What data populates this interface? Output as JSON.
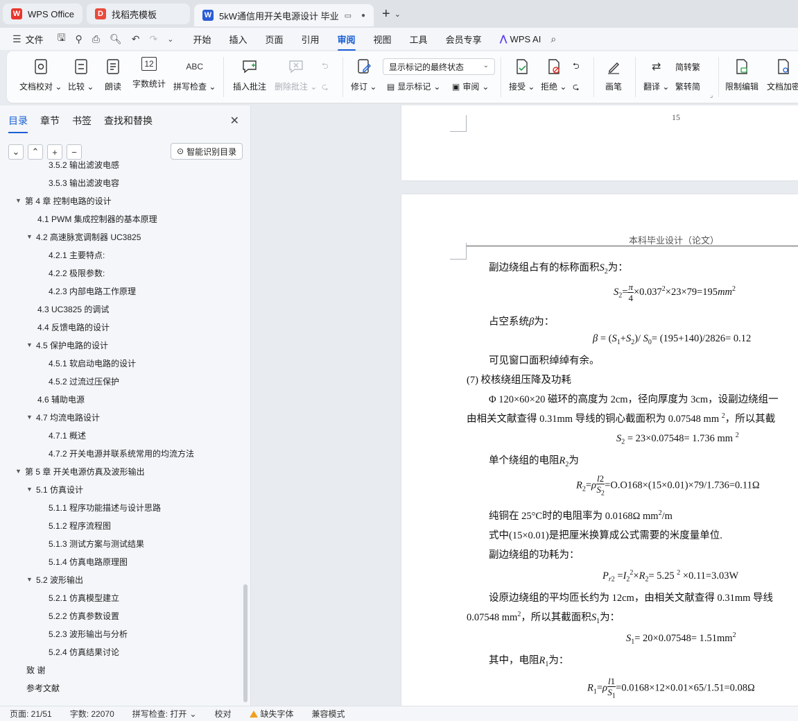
{
  "tabs": [
    {
      "label": "WPS Office",
      "icon": "wps-logo-icon"
    },
    {
      "label": "找稻壳模板",
      "icon": "docer-logo-icon"
    },
    {
      "label": "5kW通信用开关电源设计 毕业",
      "icon": "word-doc-icon"
    }
  ],
  "menu": {
    "file": "文件",
    "items": [
      "开始",
      "插入",
      "页面",
      "引用",
      "审阅",
      "视图",
      "工具",
      "会员专享"
    ],
    "active": "审阅",
    "ai": "WPS AI"
  },
  "ribbon": {
    "doc_check": "文档校对",
    "compare": "比较",
    "read_aloud": "朗读",
    "word_count": "字数统计",
    "spell_check": "拼写检查",
    "spell_icon_text": "ABC",
    "word_count_icon_text": "12",
    "insert_comment": "插入批注",
    "delete_comment": "删除批注",
    "track_changes": "修订",
    "markup_select": "显示标记的最终状态",
    "show_markup": "显示标记",
    "review_pane": "审阅",
    "accept": "接受",
    "reject": "拒绝",
    "pen": "画笔",
    "translate": "翻译",
    "to_traditional": "简转繁",
    "to_simplified": "繁转简",
    "restrict_edit": "限制编辑",
    "encrypt": "文档加密"
  },
  "sidebar": {
    "tabs": [
      "目录",
      "章节",
      "书签",
      "查找和替换"
    ],
    "active_tab": "目录",
    "smart_toc": "智能识别目录",
    "toc": [
      {
        "label": "3.5.2  输出滤波电感",
        "level": 3,
        "toggle": ""
      },
      {
        "label": "3.5.3  输出滤波电容",
        "level": 3,
        "toggle": ""
      },
      {
        "label": "第 4 章  控制电路的设计",
        "level": 1,
        "toggle": "▼"
      },
      {
        "label": "4.1 PWM 集成控制器的基本原理",
        "level": 2,
        "toggle": ""
      },
      {
        "label": "4.2  高速脉宽调制器 UC3825",
        "level": 2,
        "toggle": "▼"
      },
      {
        "label": "4.2.1  主要特点:",
        "level": 3,
        "toggle": ""
      },
      {
        "label": "4.2.2  极限参数:",
        "level": 3,
        "toggle": ""
      },
      {
        "label": "4.2.3  内部电路工作原理",
        "level": 3,
        "toggle": ""
      },
      {
        "label": "4.3    UC3825 的调试",
        "level": 2,
        "toggle": ""
      },
      {
        "label": "4.4  反馈电路的设计",
        "level": 2,
        "toggle": ""
      },
      {
        "label": "4.5 保护电路的设计",
        "level": 2,
        "toggle": "▼"
      },
      {
        "label": "4.5.1 软启动电路的设计",
        "level": 3,
        "toggle": ""
      },
      {
        "label": "4.5.2 过流过压保护",
        "level": 3,
        "toggle": ""
      },
      {
        "label": "4.6  辅助电源",
        "level": 2,
        "toggle": ""
      },
      {
        "label": "4.7  均流电路设计",
        "level": 2,
        "toggle": "▼"
      },
      {
        "label": "4.7.1  概述",
        "level": 3,
        "toggle": ""
      },
      {
        "label": "4.7.2  开关电源并联系统常用的均流方法",
        "level": 3,
        "toggle": ""
      },
      {
        "label": "第 5 章  开关电源仿真及波形输出",
        "level": 1,
        "toggle": "▼"
      },
      {
        "label": "5.1 仿真设计",
        "level": 2,
        "toggle": "▼"
      },
      {
        "label": "5.1.1 程序功能描述与设计思路",
        "level": 3,
        "toggle": ""
      },
      {
        "label": "5.1.2 程序流程图",
        "level": 3,
        "toggle": ""
      },
      {
        "label": "5.1.3 测试方案与测试结果",
        "level": 3,
        "toggle": ""
      },
      {
        "label": "5.1.4 仿真电路原理图",
        "level": 3,
        "toggle": ""
      },
      {
        "label": "5.2  波形输出",
        "level": 2,
        "toggle": "▼"
      },
      {
        "label": "5.2.1  仿真模型建立",
        "level": 3,
        "toggle": ""
      },
      {
        "label": "5.2.2  仿真参数设置",
        "level": 3,
        "toggle": ""
      },
      {
        "label": "5.2.3  波形输出与分析",
        "level": 3,
        "toggle": ""
      },
      {
        "label": "5.2.4  仿真结果讨论",
        "level": 3,
        "toggle": ""
      },
      {
        "label": "致    谢",
        "level": 1,
        "toggle": ""
      },
      {
        "label": "参考文献",
        "level": 1,
        "toggle": ""
      }
    ]
  },
  "document": {
    "page_number": "15",
    "header": "本科毕业设计（论文）",
    "p1": "副边绕组占有的标称面积",
    "p1_tail": "为：",
    "p2": "占空系统",
    "p2_tail": "为：",
    "p3": "可见窗口面积绰绰有余。",
    "p4": "(7)  校核绕组压降及功耗",
    "p5": "Φ 120×60×20 磁环的高度为 2cm，径向厚度为 3cm，设副边绕组一",
    "p6": "由相关文献查得 0.31mm 导线的铜心截面积为 0.07548 mm ",
    "p6_tail": "，所以其截",
    "eq_s2b": "= 23×0.07548= 1.736 mm ",
    "p7": "单个绕组的电阻",
    "p7_tail": "为",
    "eq_r2": "=O.O168×(15×0.01)×79/1.736=0.11Ω",
    "p8": "纯铜在 25°C时的电阻率为 0.0168Ω   mm",
    "p8_tail": "/m",
    "p9": "式中(15×0.01)是把厘米换算成公式需要的米度量单位.",
    "p10": "副边绕组的功耗为：",
    "eq_pr2": "= 5.25 ",
    "eq_pr2_tail": " ×0.11=3.03W",
    "p11": "设原边绕组的平均匝长约为 12cm，由相关文献查得 0.31mm 导线",
    "p12": "0.07548 mm",
    "p12_mid": "，所以其截面积",
    "p12_tail": "为：",
    "eq_s1": "= 20×0.07548= 1.51mm",
    "p13": "其中，电阻",
    "p13_tail": "为：",
    "eq_r1": "=0.0168×12×0.01×65/1.51=0.08Ω",
    "eq_s2": "×0.037",
    "eq_s2_tail": "×23×79=195",
    "eq_beta": "= (195+140)/2826= 0.12"
  },
  "status": {
    "page": "页面: 21/51",
    "words": "字数: 22070",
    "spell": "拼写检查: 打开",
    "proof": "校对",
    "missing_font": "缺失字体",
    "compat": "兼容模式"
  },
  "colors": {
    "accent": "#1a5fd6",
    "wps_red": "#e8362c",
    "docer_red": "#e84a3c",
    "word_blue": "#2b5cd6"
  }
}
